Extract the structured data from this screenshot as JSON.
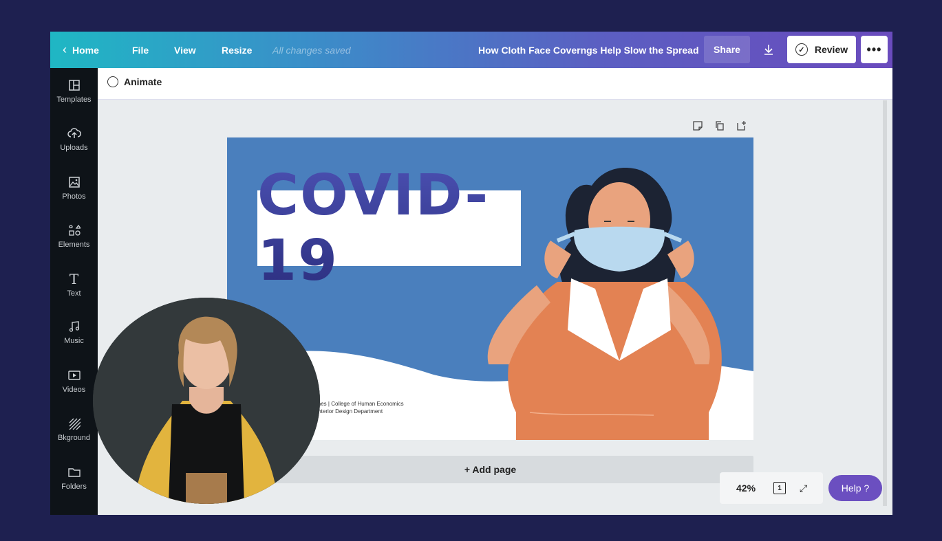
{
  "topbar": {
    "home_label": "Home",
    "file_label": "File",
    "view_label": "View",
    "resize_label": "Resize",
    "saved_status": "All changes saved",
    "doc_title": "How Cloth Face Coverngs Help Slow the Spread",
    "share_label": "Share",
    "review_label": "Review",
    "more_label": "•••"
  },
  "sidebar": {
    "items": [
      {
        "label": "Templates",
        "icon": "templates-icon"
      },
      {
        "label": "Uploads",
        "icon": "uploads-icon"
      },
      {
        "label": "Photos",
        "icon": "photos-icon"
      },
      {
        "label": "Elements",
        "icon": "elements-icon"
      },
      {
        "label": "Text",
        "icon": "text-icon"
      },
      {
        "label": "Music",
        "icon": "music-icon"
      },
      {
        "label": "Videos",
        "icon": "videos-icon"
      },
      {
        "label": "Bkground",
        "icon": "background-icon"
      },
      {
        "label": "Folders",
        "icon": "folders-icon"
      }
    ]
  },
  "toolbar": {
    "animate_label": "Animate"
  },
  "design": {
    "headline": "COVID-19",
    "credit_line1": "ines | College of Human Economics",
    "credit_line2": "Interior Design Department"
  },
  "canvas": {
    "add_page_label": "+ Add page",
    "zoom": "42%",
    "page_count": "1",
    "help_label": "Help  ?"
  },
  "colors": {
    "frame_bg": "#1e2050",
    "design_bg": "#4a7fbd",
    "help_purple": "#6b4fc0"
  }
}
